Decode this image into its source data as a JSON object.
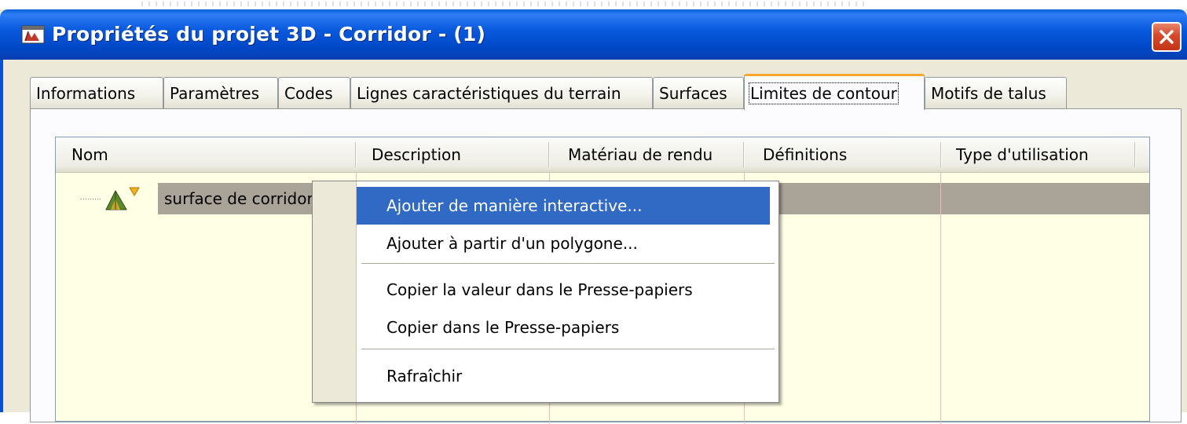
{
  "window": {
    "title": "Propriétés du projet 3D - Corridor - (1)"
  },
  "tabs": [
    {
      "label": "Informations"
    },
    {
      "label": "Paramètres"
    },
    {
      "label": "Codes"
    },
    {
      "label": "Lignes caractéristiques du terrain"
    },
    {
      "label": "Surfaces"
    },
    {
      "label": "Limites de contour",
      "active": true
    },
    {
      "label": "Motifs de talus"
    }
  ],
  "grid": {
    "columns": [
      "Nom",
      "Description",
      "Matériau de rendu",
      "Définitions",
      "Type d'utilisation"
    ],
    "rows": [
      {
        "name": "surface de corridor",
        "icon": "corridor-surface-icon"
      }
    ]
  },
  "context_menu": {
    "items": [
      {
        "label": "Ajouter de manière interactive...",
        "highlighted": true
      },
      {
        "label": "Ajouter à partir d'un polygone..."
      },
      {
        "label": "Copier la valeur dans le Presse-papiers"
      },
      {
        "label": "Copier dans le Presse-papiers"
      },
      {
        "label": "Rafraîchir"
      }
    ]
  },
  "colors": {
    "titlebar": "#0a5ade",
    "active_tab_accent": "#f7a82c",
    "menu_highlight": "#316ac5",
    "grid_background": "#ffffe6",
    "selected_row": "#aaa398"
  }
}
